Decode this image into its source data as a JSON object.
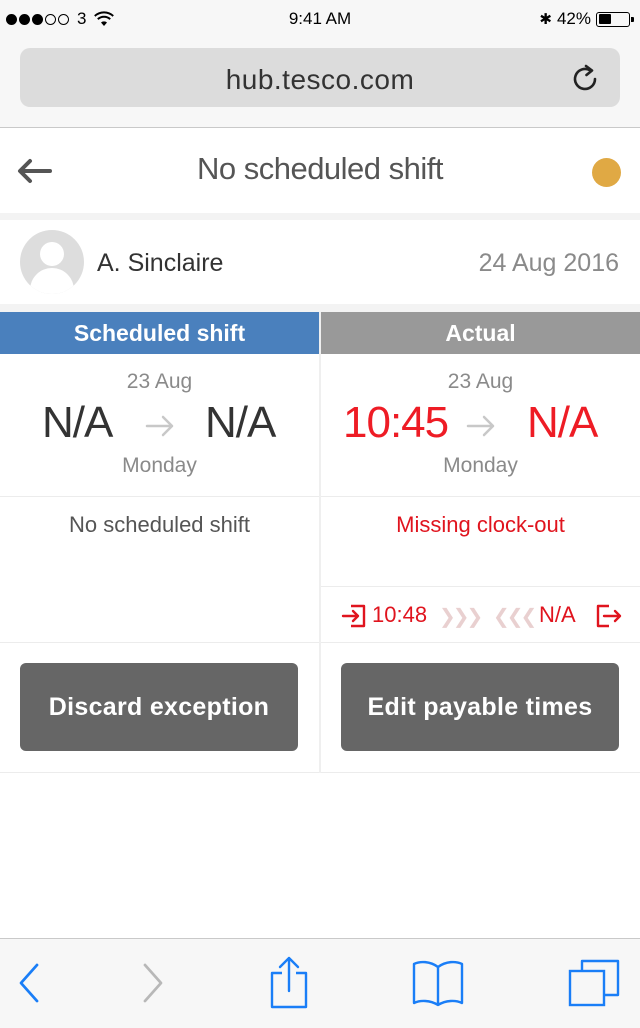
{
  "status_bar": {
    "signal_dots_filled": 3,
    "signal_dots_total": 5,
    "carrier": "3",
    "time": "9:41 AM",
    "bluetooth": "✱",
    "battery_percent": "42%",
    "battery_level": 0.42
  },
  "browser": {
    "url": "hub.tesco.com"
  },
  "header": {
    "title": "No scheduled shift",
    "status_color": "#e0a944"
  },
  "employee": {
    "name": "A. Sinclaire",
    "date": "24 Aug 2016"
  },
  "scheduled": {
    "heading": "Scheduled shift",
    "date": "23 Aug",
    "start": "N/A",
    "end": "N/A",
    "day": "Monday",
    "note": "No scheduled shift",
    "button": "Discard exception"
  },
  "actual": {
    "heading": "Actual",
    "date": "23 Aug",
    "start": "10:45",
    "end": "N/A",
    "day": "Monday",
    "note": "Missing clock-out",
    "clock_in": "10:48",
    "clock_in_chevrons": "❯❯❯",
    "clock_out_chevrons": "❮❮❮",
    "clock_out": "N/A",
    "button": "Edit payable times"
  },
  "colors": {
    "scheduled_header": "#4a80bd",
    "actual_header": "#999999",
    "alert_red": "#ee1c25",
    "button_bg": "#666666",
    "ios_blue": "#1a7ef7"
  },
  "toolbar": {
    "icons": [
      "back-icon",
      "forward-icon",
      "share-icon",
      "bookmarks-icon",
      "tabs-icon"
    ]
  }
}
